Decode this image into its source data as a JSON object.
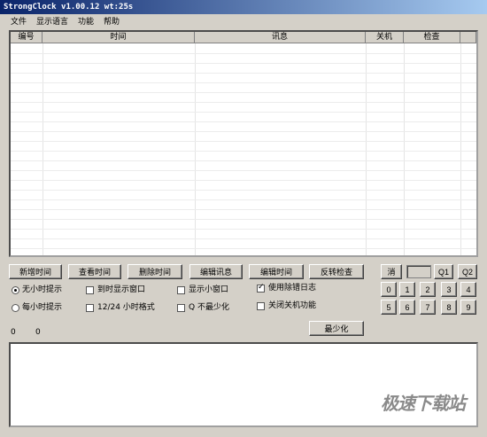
{
  "window": {
    "title": "StrongClock v1.00.12 wt:25s"
  },
  "menu": {
    "file": "文件",
    "language": "显示语言",
    "functions": "功能",
    "help": "帮助"
  },
  "table": {
    "columns": [
      "编号",
      "时间",
      "讯息",
      "关机",
      "检查"
    ],
    "rows": []
  },
  "buttons": {
    "add_time": "新增时间",
    "view_time": "查看时间",
    "delete_time": "删除时间",
    "edit_message": "编辑讯息",
    "edit_time": "编辑时间",
    "invert_check": "反转检查",
    "minimize": "最少化"
  },
  "keypad": {
    "clear": "消",
    "q1": "Q1",
    "q2": "Q2",
    "row1": [
      "0",
      "1",
      "2",
      "3",
      "4"
    ],
    "row2": [
      "5",
      "6",
      "7",
      "8",
      "9"
    ]
  },
  "options": {
    "no_hourly": {
      "label": "无小时提示",
      "selected": true
    },
    "hourly": {
      "label": "每小时提示",
      "selected": false
    },
    "show_window_on_time": {
      "label": "到时显示窗口",
      "checked": false
    },
    "format_12_24": {
      "label": "12/24 小时格式",
      "checked": false
    },
    "show_small_window": {
      "label": "显示小窗口",
      "checked": false
    },
    "q_no_minimize": {
      "label": "Q 不最少化",
      "checked": false
    },
    "debug_log": {
      "label": "使用除错日志",
      "checked": true
    },
    "disable_shutdown": {
      "label": "关闭关机功能",
      "checked": false
    }
  },
  "counters": {
    "a": "0",
    "b": "0"
  },
  "watermark": "极速下载站"
}
